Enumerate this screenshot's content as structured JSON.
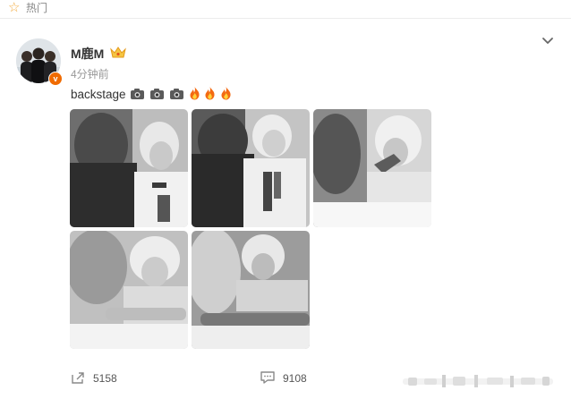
{
  "section": {
    "label": "热门",
    "icon": "star-icon"
  },
  "post": {
    "username": "M鹿M",
    "time": "4分钟前",
    "text": "backstage",
    "emojis": [
      "camera-icon",
      "camera-icon",
      "camera-icon",
      "fire-icon",
      "fire-icon",
      "fire-icon"
    ],
    "images": [
      "photo-1",
      "photo-2",
      "photo-3",
      "photo-4",
      "photo-5"
    ]
  },
  "actions": {
    "repost_count": "5158",
    "comment_count": "9108"
  },
  "colors": {
    "accent": "#f2a93b",
    "verified": "#f06b00",
    "text": "#333333",
    "muted": "#999999"
  }
}
